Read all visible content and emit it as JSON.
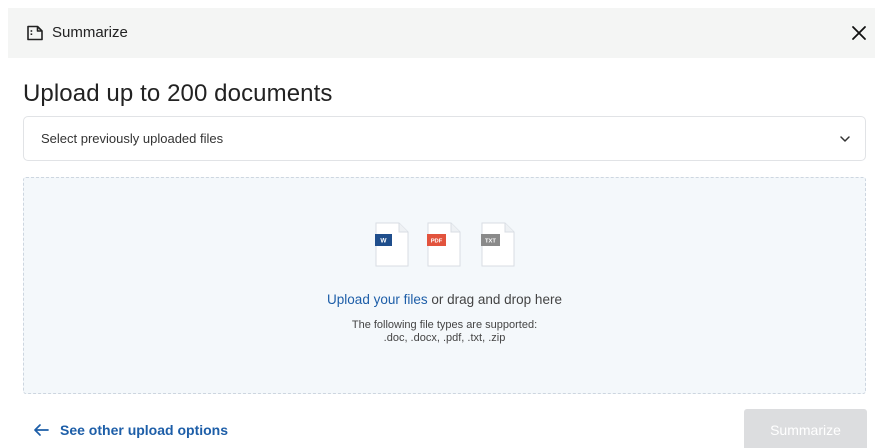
{
  "header": {
    "title": "Summarize",
    "icon": "document-summary-icon",
    "close_icon": "close-icon"
  },
  "main": {
    "title": "Upload up to 200 documents",
    "select": {
      "value": "Select previously uploaded files",
      "icon": "chevron-down-icon"
    },
    "dropzone": {
      "file_icons": [
        {
          "name": "word-file-icon",
          "label": "W",
          "color": "#1f4e8c"
        },
        {
          "name": "pdf-file-icon",
          "label": "PDF",
          "color": "#e2533d"
        },
        {
          "name": "txt-file-icon",
          "label": "TXT",
          "color": "#8a8a8a"
        }
      ],
      "upload_link": "Upload your files",
      "upload_suffix": " or drag and drop here",
      "supported_label": "The following file types are supported:",
      "supported_types": ".doc, .docx, .pdf, .txt, .zip"
    }
  },
  "footer": {
    "back_label": "See other upload options",
    "submit_label": "Summarize",
    "submit_disabled": true
  },
  "colors": {
    "link": "#1d5ea8",
    "header_bg": "#f4f5f4",
    "dropzone_bg": "#f4f8fb",
    "button_disabled_bg": "#dcdddf"
  }
}
